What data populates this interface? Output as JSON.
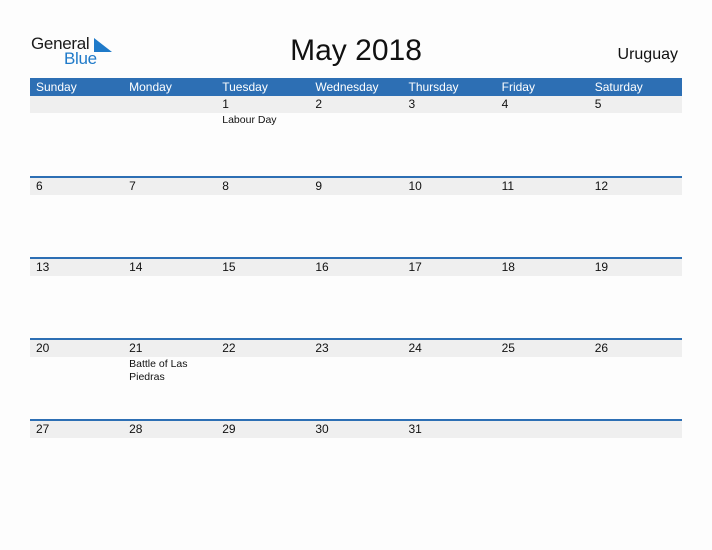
{
  "logo": {
    "general": "General",
    "blue": "Blue",
    "icon": "triangle-flag-icon",
    "brand_color": "#1f7ac9"
  },
  "title": "May 2018",
  "country": "Uruguay",
  "header_color": "#2d6fb4",
  "weekdays": [
    "Sunday",
    "Monday",
    "Tuesday",
    "Wednesday",
    "Thursday",
    "Friday",
    "Saturday"
  ],
  "weeks": [
    {
      "days": [
        "",
        "",
        "1",
        "2",
        "3",
        "4",
        "5"
      ],
      "events": [
        "",
        "",
        "Labour Day",
        "",
        "",
        "",
        ""
      ]
    },
    {
      "days": [
        "6",
        "7",
        "8",
        "9",
        "10",
        "11",
        "12"
      ],
      "events": [
        "",
        "",
        "",
        "",
        "",
        "",
        ""
      ]
    },
    {
      "days": [
        "13",
        "14",
        "15",
        "16",
        "17",
        "18",
        "19"
      ],
      "events": [
        "",
        "",
        "",
        "",
        "",
        "",
        ""
      ]
    },
    {
      "days": [
        "20",
        "21",
        "22",
        "23",
        "24",
        "25",
        "26"
      ],
      "events": [
        "",
        "Battle of Las Piedras",
        "",
        "",
        "",
        "",
        ""
      ]
    },
    {
      "days": [
        "27",
        "28",
        "29",
        "30",
        "31",
        "",
        ""
      ],
      "events": [
        "",
        "",
        "",
        "",
        "",
        "",
        ""
      ]
    }
  ]
}
